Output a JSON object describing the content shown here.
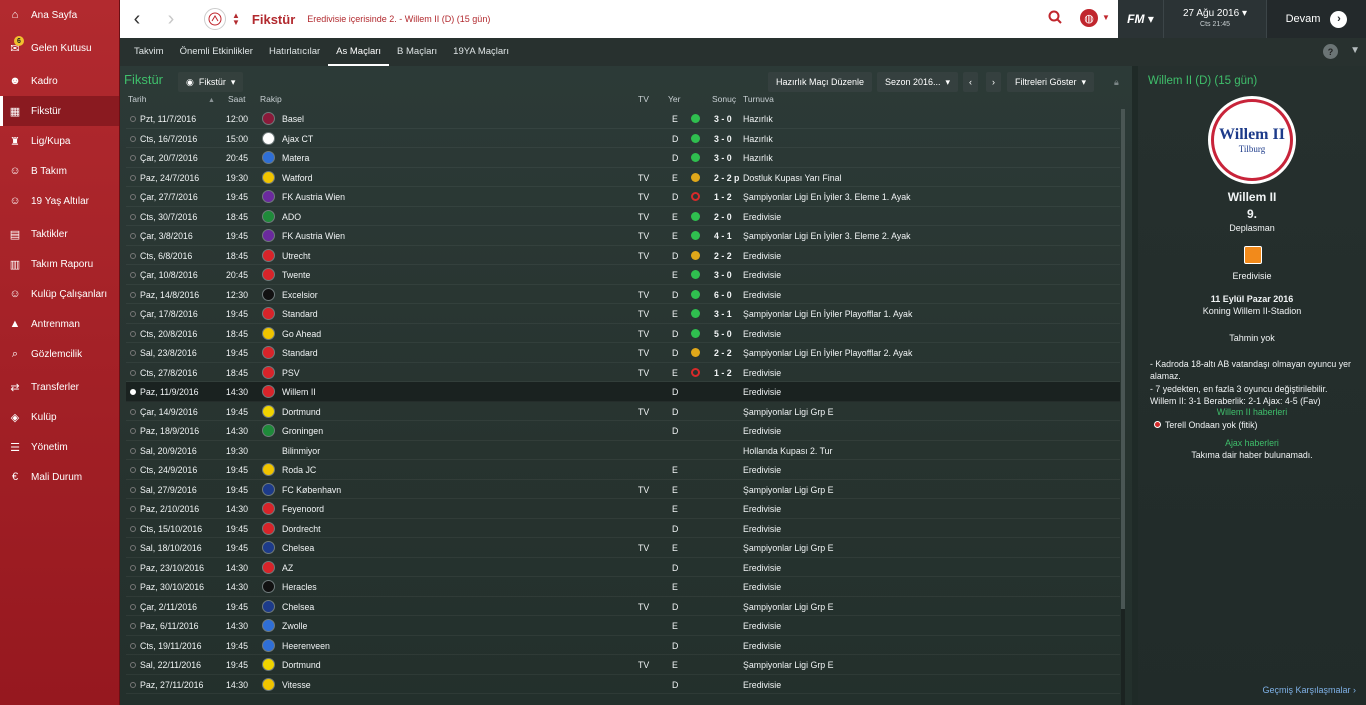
{
  "sidebar": {
    "items": [
      {
        "label": "Ana Sayfa",
        "icon": "home-icon"
      },
      {
        "label": "Gelen Kutusu",
        "icon": "inbox-icon",
        "badge": "6"
      },
      {
        "label": "Kadro",
        "icon": "squad-icon"
      },
      {
        "label": "Fikstür",
        "icon": "calendar-icon",
        "active": true
      },
      {
        "label": "Lig/Kupa",
        "icon": "trophy-icon"
      },
      {
        "label": "B Takım",
        "icon": "team-b-icon"
      },
      {
        "label": "19 Yaş Altılar",
        "icon": "youth-team-icon"
      },
      {
        "label": "Taktikler",
        "icon": "tactics-icon"
      },
      {
        "label": "Takım Raporu",
        "icon": "report-icon"
      },
      {
        "label": "Kulüp Çalışanları",
        "icon": "staff-icon"
      },
      {
        "label": "Antrenman",
        "icon": "training-icon"
      },
      {
        "label": "Gözlemcilik",
        "icon": "scouting-icon"
      },
      {
        "label": "Transferler",
        "icon": "transfers-icon"
      },
      {
        "label": "Kulüp",
        "icon": "club-icon"
      },
      {
        "label": "Yönetim",
        "icon": "board-icon"
      },
      {
        "label": "Mali Durum",
        "icon": "finances-icon"
      }
    ]
  },
  "topbar": {
    "title": "Fikstür",
    "subtitle": "Eredivisie içerisinde 2. - Willem II (D) (15 gün)",
    "date": "27 Ağu 2016",
    "time": "Cts 21:45",
    "continue_label": "Devam",
    "logo": "FM"
  },
  "tabs": [
    "Takvim",
    "Önemli Etkinlikler",
    "Hatırlatıcılar",
    "As Maçları",
    "B Maçları",
    "19YA Maçları"
  ],
  "active_tab": "As Maçları",
  "main": {
    "title": "Fikstür",
    "view_dropdown": "Fikstür",
    "friendly_button": "Hazırlık Maçı Düzenle",
    "season_dropdown": "Sezon 2016...",
    "filter_button": "Filtreleri Göster",
    "columns": {
      "date": "Tarih",
      "time": "Saat",
      "opponent": "Rakip",
      "tv": "TV",
      "venue": "Yer",
      "result": "Sonuç",
      "competition": "Turnuva"
    }
  },
  "fixtures": [
    {
      "date": "Pzt, 11/7/2016",
      "time": "12:00",
      "opponent": "Basel",
      "tv": "",
      "venue": "E",
      "result": "win",
      "score": "3 - 0",
      "competition": "Hazırlık",
      "crest": "#8a1a3a"
    },
    {
      "date": "Cts, 16/7/2016",
      "time": "15:00",
      "opponent": "Ajax CT",
      "tv": "",
      "venue": "D",
      "result": "win",
      "score": "3 - 0",
      "competition": "Hazırlık",
      "crest": "#ffffff"
    },
    {
      "date": "Çar, 20/7/2016",
      "time": "20:45",
      "opponent": "Matera",
      "tv": "",
      "venue": "D",
      "result": "win",
      "score": "3 - 0",
      "competition": "Hazırlık",
      "crest": "#2f6fd6"
    },
    {
      "date": "Paz, 24/7/2016",
      "time": "19:30",
      "opponent": "Watford",
      "tv": "TV",
      "venue": "E",
      "result": "draw",
      "score": "2 - 2 p",
      "competition": "Dostluk Kupası Yarı Final",
      "crest": "#f0c400"
    },
    {
      "date": "Çar, 27/7/2016",
      "time": "19:45",
      "opponent": "FK Austria Wien",
      "tv": "TV",
      "venue": "D",
      "result": "loss",
      "score": "1 - 2",
      "competition": "Şampiyonlar Ligi En İyiler 3. Eleme 1. Ayak",
      "crest": "#6b2a9e"
    },
    {
      "date": "Cts, 30/7/2016",
      "time": "18:45",
      "opponent": "ADO",
      "tv": "TV",
      "venue": "E",
      "result": "win",
      "score": "2 - 0",
      "competition": "Eredivisie",
      "crest": "#1f8a3a"
    },
    {
      "date": "Çar, 3/8/2016",
      "time": "19:45",
      "opponent": "FK Austria Wien",
      "tv": "TV",
      "venue": "E",
      "result": "win",
      "score": "4 - 1",
      "competition": "Şampiyonlar Ligi En İyiler 3. Eleme 2. Ayak",
      "crest": "#6b2a9e"
    },
    {
      "date": "Cts, 6/8/2016",
      "time": "18:45",
      "opponent": "Utrecht",
      "tv": "TV",
      "venue": "D",
      "result": "draw",
      "score": "2 - 2",
      "competition": "Eredivisie",
      "crest": "#d8242a"
    },
    {
      "date": "Çar, 10/8/2016",
      "time": "20:45",
      "opponent": "Twente",
      "tv": "",
      "venue": "E",
      "result": "win",
      "score": "3 - 0",
      "competition": "Eredivisie",
      "crest": "#d8242a"
    },
    {
      "date": "Paz, 14/8/2016",
      "time": "12:30",
      "opponent": "Excelsior",
      "tv": "TV",
      "venue": "D",
      "result": "win",
      "score": "6 - 0",
      "competition": "Eredivisie",
      "crest": "#111111"
    },
    {
      "date": "Çar, 17/8/2016",
      "time": "19:45",
      "opponent": "Standard",
      "tv": "TV",
      "venue": "E",
      "result": "win",
      "score": "3 - 1",
      "competition": "Şampiyonlar Ligi En İyiler Playofflar 1. Ayak",
      "crest": "#d8242a"
    },
    {
      "date": "Cts, 20/8/2016",
      "time": "18:45",
      "opponent": "Go Ahead",
      "tv": "TV",
      "venue": "D",
      "result": "win",
      "score": "5 - 0",
      "competition": "Eredivisie",
      "crest": "#f0c400"
    },
    {
      "date": "Sal, 23/8/2016",
      "time": "19:45",
      "opponent": "Standard",
      "tv": "TV",
      "venue": "D",
      "result": "draw",
      "score": "2 - 2",
      "competition": "Şampiyonlar Ligi En İyiler Playofflar 2. Ayak",
      "crest": "#d8242a"
    },
    {
      "date": "Cts, 27/8/2016",
      "time": "18:45",
      "opponent": "PSV",
      "tv": "TV",
      "venue": "E",
      "result": "loss",
      "score": "1 - 2",
      "competition": "Eredivisie",
      "crest": "#d8242a"
    },
    {
      "date": "Paz, 11/9/2016",
      "time": "14:30",
      "opponent": "Willem II",
      "tv": "",
      "venue": "D",
      "result": "",
      "score": "",
      "competition": "Eredivisie",
      "crest": "#d8242a",
      "selected": true
    },
    {
      "date": "Çar, 14/9/2016",
      "time": "19:45",
      "opponent": "Dortmund",
      "tv": "TV",
      "venue": "D",
      "result": "",
      "score": "",
      "competition": "Şampiyonlar Ligi Grp E",
      "crest": "#f0d400"
    },
    {
      "date": "Paz, 18/9/2016",
      "time": "14:30",
      "opponent": "Groningen",
      "tv": "",
      "venue": "D",
      "result": "",
      "score": "",
      "competition": "Eredivisie",
      "crest": "#1f8a3a"
    },
    {
      "date": "Sal, 20/9/2016",
      "time": "19:30",
      "opponent": "Bilinmiyor",
      "tv": "",
      "venue": "",
      "result": "",
      "score": "",
      "competition": "Hollanda Kupası 2. Tur",
      "crest": ""
    },
    {
      "date": "Cts, 24/9/2016",
      "time": "19:45",
      "opponent": "Roda JC",
      "tv": "",
      "venue": "E",
      "result": "",
      "score": "",
      "competition": "Eredivisie",
      "crest": "#f0c400"
    },
    {
      "date": "Sal, 27/9/2016",
      "time": "19:45",
      "opponent": "FC København",
      "tv": "TV",
      "venue": "E",
      "result": "",
      "score": "",
      "competition": "Şampiyonlar Ligi Grp E",
      "crest": "#1d3b8a"
    },
    {
      "date": "Paz, 2/10/2016",
      "time": "14:30",
      "opponent": "Feyenoord",
      "tv": "",
      "venue": "E",
      "result": "",
      "score": "",
      "competition": "Eredivisie",
      "crest": "#d8242a"
    },
    {
      "date": "Cts, 15/10/2016",
      "time": "19:45",
      "opponent": "Dordrecht",
      "tv": "",
      "venue": "D",
      "result": "",
      "score": "",
      "competition": "Eredivisie",
      "crest": "#d8242a"
    },
    {
      "date": "Sal, 18/10/2016",
      "time": "19:45",
      "opponent": "Chelsea",
      "tv": "TV",
      "venue": "E",
      "result": "",
      "score": "",
      "competition": "Şampiyonlar Ligi Grp E",
      "crest": "#1d3b8a"
    },
    {
      "date": "Paz, 23/10/2016",
      "time": "14:30",
      "opponent": "AZ",
      "tv": "",
      "venue": "D",
      "result": "",
      "score": "",
      "competition": "Eredivisie",
      "crest": "#d8242a"
    },
    {
      "date": "Paz, 30/10/2016",
      "time": "14:30",
      "opponent": "Heracles",
      "tv": "",
      "venue": "E",
      "result": "",
      "score": "",
      "competition": "Eredivisie",
      "crest": "#111111"
    },
    {
      "date": "Çar, 2/11/2016",
      "time": "19:45",
      "opponent": "Chelsea",
      "tv": "TV",
      "venue": "D",
      "result": "",
      "score": "",
      "competition": "Şampiyonlar Ligi Grp E",
      "crest": "#1d3b8a"
    },
    {
      "date": "Paz, 6/11/2016",
      "time": "14:30",
      "opponent": "Zwolle",
      "tv": "",
      "venue": "E",
      "result": "",
      "score": "",
      "competition": "Eredivisie",
      "crest": "#2f6fd6"
    },
    {
      "date": "Cts, 19/11/2016",
      "time": "19:45",
      "opponent": "Heerenveen",
      "tv": "",
      "venue": "D",
      "result": "",
      "score": "",
      "competition": "Eredivisie",
      "crest": "#2f6fd6"
    },
    {
      "date": "Sal, 22/11/2016",
      "time": "19:45",
      "opponent": "Dortmund",
      "tv": "TV",
      "venue": "E",
      "result": "",
      "score": "",
      "competition": "Şampiyonlar Ligi Grp E",
      "crest": "#f0d400"
    },
    {
      "date": "Paz, 27/11/2016",
      "time": "14:30",
      "opponent": "Vitesse",
      "tv": "",
      "venue": "D",
      "result": "",
      "score": "",
      "competition": "Eredivisie",
      "crest": "#f0c400"
    }
  ],
  "result_colors": {
    "win": "#2fbf4f",
    "draw": "#e0a81a",
    "loss": "#d82a2a"
  },
  "panel": {
    "title": "Willem II (D) (15 gün)",
    "crest_text": "Willem II",
    "crest_city": "Tilburg",
    "team_name": "Willem II",
    "position": "9.",
    "venue_type": "Deplasman",
    "competition": "Eredivisie",
    "match_date": "11 Eylül Pazar 2016",
    "stadium": "Koning Willem II-Stadion",
    "prediction": "Tahmin yok",
    "note1": "- Kadroda 18-altı AB vatandaşı olmayan oyuncu yer alamaz.",
    "note2": "- 7 yedekten, en fazla 3 oyuncu değiştirilebilir.",
    "head_to_head": "Willem II: 3-1 Beraberlik: 2-1 Ajax: 4-5 (Fav)",
    "opp_news_title": "Willem II haberleri",
    "opp_news_item": "Terell Ondaan yok (fitik)",
    "own_news_title": "Ajax haberleri",
    "own_news_item": "Takıma dair haber bulunamadı.",
    "h2h_link": "Geçmiş Karşılaşmalar"
  }
}
